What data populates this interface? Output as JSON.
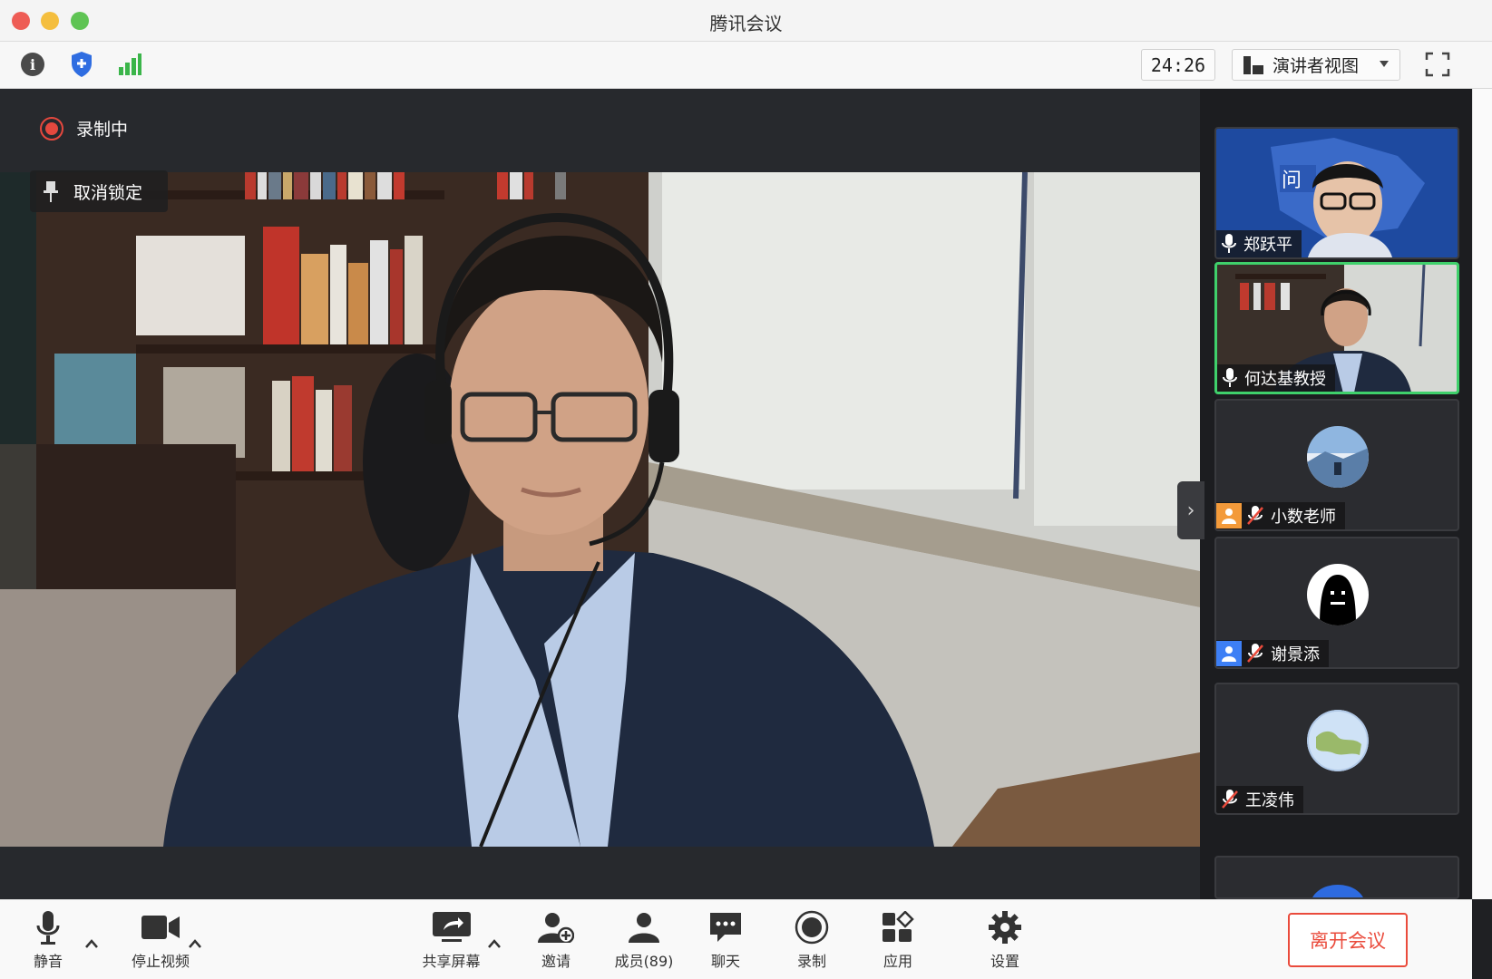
{
  "window": {
    "title": "腾讯会议"
  },
  "toolbar": {
    "timer": "24:26",
    "view_mode": "演讲者视图"
  },
  "stage": {
    "recording_label": "录制中",
    "unlock_label": "取消锁定"
  },
  "participants": [
    {
      "name": "郑跃平",
      "mic": "on",
      "video": true
    },
    {
      "name": "何达基教授",
      "mic": "on",
      "video": true,
      "active_speaker": true
    },
    {
      "name": "小数老师",
      "mic": "muted",
      "video": false,
      "badge": "orange-user"
    },
    {
      "name": "谢景添",
      "mic": "muted",
      "video": false,
      "badge": "blue-user"
    },
    {
      "name": "王凌伟",
      "mic": "muted",
      "video": false
    }
  ],
  "bottombar": {
    "mute_label": "静音",
    "stop_video_label": "停止视频",
    "share_label": "共享屏幕",
    "invite_label": "邀请",
    "members_label": "成员(89)",
    "chat_label": "聊天",
    "record_label": "录制",
    "apps_label": "应用",
    "settings_label": "设置",
    "leave_label": "离开会议"
  },
  "colors": {
    "active_speaker": "#3fd06b",
    "recording": "#e5483e",
    "leave": "#ea4b3c"
  }
}
